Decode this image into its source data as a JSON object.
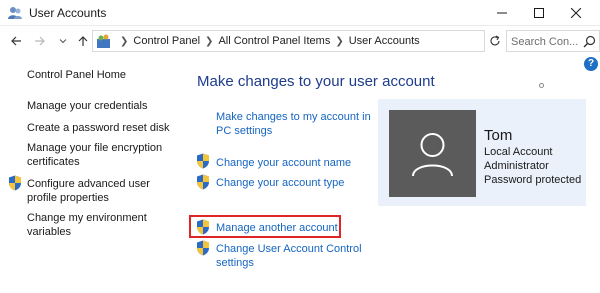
{
  "window": {
    "title": "User Accounts",
    "controls": [
      "minimize-icon",
      "maximize-icon",
      "close-icon"
    ]
  },
  "address_bar": {
    "breadcrumbs": [
      "Control Panel",
      "All Control Panel Items",
      "User Accounts"
    ],
    "search_placeholder": "Search Con..."
  },
  "sidebar": {
    "home": "Control Panel Home",
    "items": [
      "Manage your credentials",
      "Create a password reset disk",
      "Manage your file encryption certificates",
      "Configure advanced user profile properties",
      "Change my environment variables"
    ]
  },
  "main": {
    "heading": "Make changes to your user account",
    "links": {
      "pc_settings": "Make changes to my account in PC settings",
      "change_name": "Change your account name",
      "change_type": "Change your account type",
      "manage_another": "Manage another account",
      "uac": "Change User Account Control settings"
    }
  },
  "account": {
    "name": "Tom",
    "details": [
      "Local Account",
      "Administrator",
      "Password protected"
    ]
  },
  "colors": {
    "link": "#1565c0",
    "heading": "#1e3c8c",
    "highlight": "#e02525",
    "panel": "#eaf1fb",
    "avatar": "#5b5b5b"
  }
}
